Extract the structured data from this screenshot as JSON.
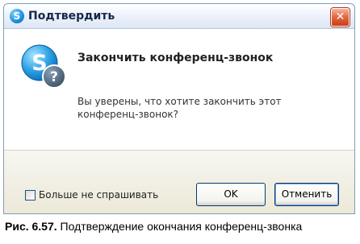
{
  "window": {
    "title": "Подтвердить",
    "close_glyph": "✕"
  },
  "content": {
    "heading": "Закончить конференц-звонок",
    "message": "Вы уверены, что хотите закончить этот конференц-звонок?",
    "icon": "skype-question-icon"
  },
  "footer": {
    "checkbox_label": "Больше не спрашивать",
    "checkbox_checked": false,
    "ok_label": "OK",
    "cancel_label": "Отменить"
  },
  "caption": {
    "number": "Рис. 6.57.",
    "text": "Подтверждение окончания конференц-звонка"
  }
}
